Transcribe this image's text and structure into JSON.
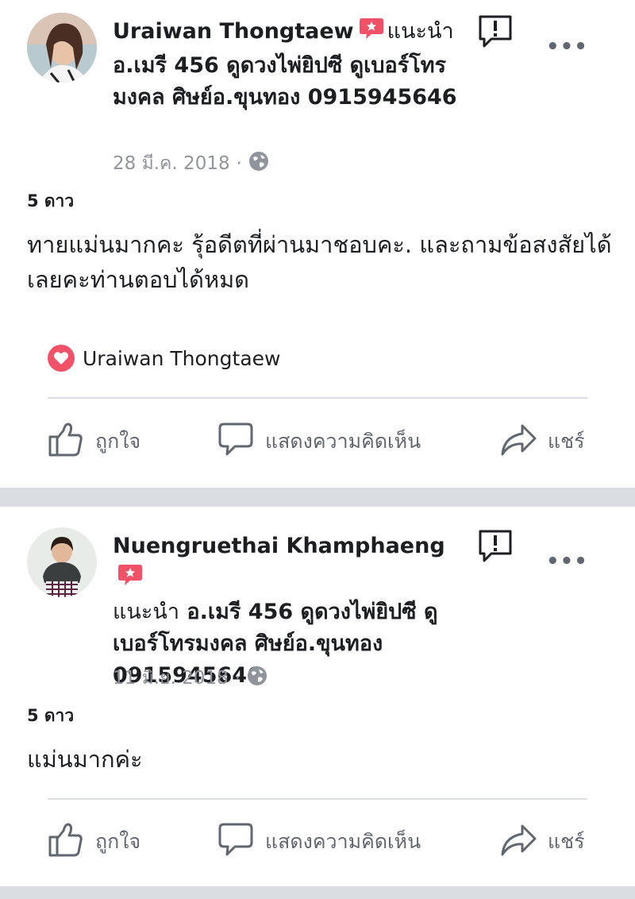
{
  "posts": [
    {
      "author": "Uraiwan Thongtaew",
      "recommends": "แนะนำ",
      "page_name": "อ.เมรี 456 ดูดวงไพ่ยิปซี ดูเบอร์โทรมงคล ศิษย์อ.ขุนทอง 0915945646",
      "date": "28 มี.ค. 2018",
      "separator": "·",
      "rating": "5 ดาว",
      "review": "ทายแม่นมากคะ รุ้อดีตที่ผ่านมาชอบคะ. และถามข้อสงสัยได้เลยคะท่านตอบได้หมด",
      "liker": "Uraiwan Thongtaew",
      "more": "•••"
    },
    {
      "author": "Nuengruethai Khamphaeng",
      "recommends": "แนะนำ",
      "page_name": "อ.เมรี 456 ดูดวงไพ่ยิปซี ดูเบอร์โทรมงคล ศิษย์อ.ขุนทอง 0915945646",
      "date": "11 มิ.ย. 2018",
      "separator": "·",
      "rating": "5 ดาว",
      "review": "แม่นมากค่ะ",
      "more": "•••"
    }
  ],
  "actions": {
    "like": "ถูกใจ",
    "comment": "แสดงความคิดเห็น",
    "share": "แชร์"
  },
  "icons": [
    "recommend-icon",
    "report-icon",
    "globe-icon",
    "heart-icon",
    "like-icon",
    "comment-icon",
    "share-icon"
  ],
  "colors": {
    "recommend_red": "#f25268",
    "text": "#1c1e21",
    "muted": "#90949c",
    "action_gray": "#606770",
    "separator": "#dadde1"
  }
}
